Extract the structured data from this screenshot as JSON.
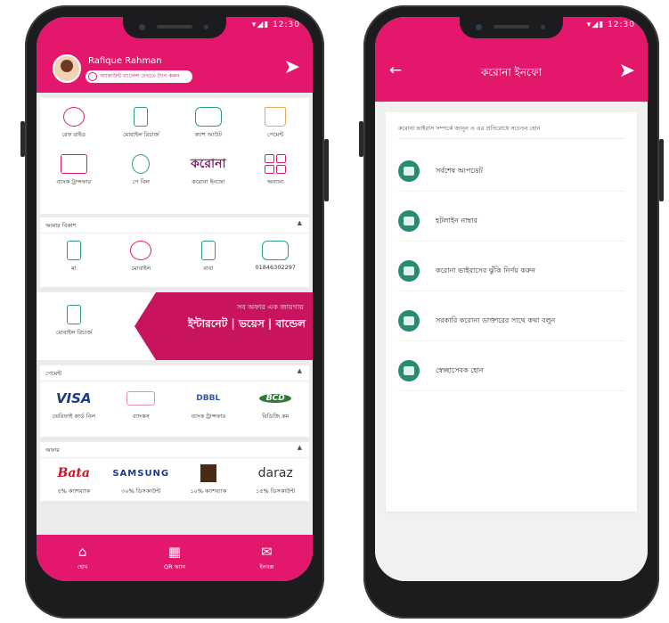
{
  "left_phone": {
    "status_time": "12:30",
    "user_name": "Rafique Rahman",
    "user_pill": "অ্যাকাউন্ট ব্যালেন্স দেখতে ট্যাপ করুন",
    "quick_actions": [
      {
        "label": "রেফ রাইড",
        "icon": "coin-transfer-icon"
      },
      {
        "label": "মোবাইল রিচার্জ",
        "icon": "mobile-recharge-icon"
      },
      {
        "label": "ক্যাশ আউট",
        "icon": "cash-out-icon"
      },
      {
        "label": "পেমেন্ট",
        "icon": "shopping-bag-icon"
      },
      {
        "label": "ব্যাংক ট্রান্সফার",
        "icon": "bank-card-icon"
      },
      {
        "label": "পে বিল",
        "icon": "bulb-bill-icon"
      },
      {
        "label": "করোনা ইনফো",
        "icon": "corona-info-logo"
      },
      {
        "label": "অন্যান্য",
        "icon": "more-tiles-icon"
      }
    ],
    "section_send": {
      "title": "আমার বিকাশ",
      "items": [
        {
          "label": "মা",
          "icon": "mobile-icon"
        },
        {
          "label": "মোবাইল",
          "icon": "coin-transfer-icon"
        },
        {
          "label": "বাবা",
          "icon": "mobile-icon"
        },
        {
          "label": "01846302297",
          "icon": "cash-out-icon"
        }
      ]
    },
    "banner": {
      "left_label": "মোবাইল রিচার্জ",
      "line1": "সব অফার এক জায়গায়",
      "line2": "ইন্টারনেট | ভয়েস | বান্ডেল"
    },
    "section_payment": {
      "title": "পেমেন্ট",
      "items": [
        {
          "logo": "VISA",
          "label": "ভেরিফাই কার্ড বিল"
        },
        {
          "logo": "",
          "label": "ব্যাংকস"
        },
        {
          "logo": "DBBL",
          "label": "ব্যাংক ট্রান্সফার"
        },
        {
          "logo": "BCD",
          "label": "বিডিজি.কম"
        }
      ]
    },
    "section_offers": {
      "title": "অফার",
      "items": [
        {
          "logo": "Bata",
          "label": "৫% ক্যাশব্যাক"
        },
        {
          "logo": "SAMSUNG",
          "label": "৩০% ডিসকাউন্ট"
        },
        {
          "logo": "",
          "label": "১০% ক্যাশব্যাক"
        },
        {
          "logo": "daraz",
          "label": "১৫% ডিসকাউন্ট"
        }
      ]
    },
    "bottom_nav": [
      {
        "label": "হোম",
        "icon": "home-icon"
      },
      {
        "label": "QR স্ক্যান",
        "icon": "qr-scan-icon"
      },
      {
        "label": "ইনবক্স",
        "icon": "mail-icon"
      }
    ]
  },
  "right_phone": {
    "status_time": "12:30",
    "title": "করোনা ইনফো",
    "intro": "করোনা ভাইরাস সম্পর্কে জানুন ও এর প্রতিরোধে সচেতন হোন",
    "items": [
      {
        "label": "সর্বশেষ আপডেট",
        "icon": "info-card-icon"
      },
      {
        "label": "হটলাইন নাম্বার",
        "icon": "info-card-icon"
      },
      {
        "label": "করোনা ভাইরাসের ঝুঁকি নির্ণয় করুন",
        "icon": "info-card-icon"
      },
      {
        "label": "সরকারি করোনা ডাক্তারের সাথে কথা বলুন",
        "icon": "info-card-icon"
      },
      {
        "label": "স্বেচ্ছাসেবক হোন",
        "icon": "info-card-icon"
      }
    ]
  }
}
